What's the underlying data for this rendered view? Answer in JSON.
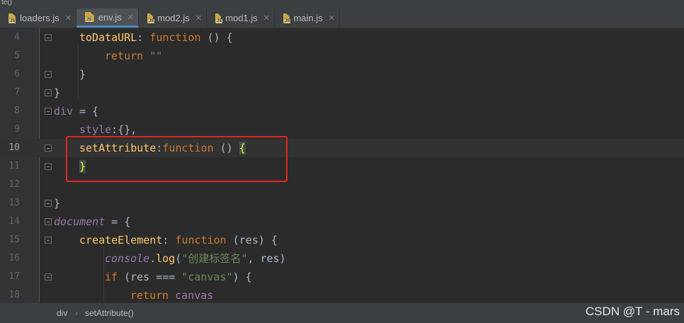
{
  "window": {
    "title_fragment": "te()"
  },
  "tabs": [
    {
      "label": "loaders.js",
      "active": false
    },
    {
      "label": "env.js",
      "active": true
    },
    {
      "label": "mod2.js",
      "active": false
    },
    {
      "label": "mod1.js",
      "active": false
    },
    {
      "label": "main.js",
      "active": false
    }
  ],
  "editor": {
    "lines": [
      {
        "num": "4",
        "code": [
          [
            "prop",
            "toDataURL"
          ],
          [
            "plain",
            ": "
          ],
          [
            "kw",
            "function"
          ],
          [
            "plain",
            " () {"
          ]
        ]
      },
      {
        "num": "5",
        "code": [
          [
            "kw",
            "return"
          ],
          [
            "plain",
            " "
          ],
          [
            "str",
            "\"\""
          ]
        ]
      },
      {
        "num": "6",
        "code": [
          [
            "plain",
            "}"
          ]
        ]
      },
      {
        "num": "7",
        "code": [
          [
            "plain",
            "}"
          ]
        ]
      },
      {
        "num": "8",
        "code": [
          [
            "mem",
            "div"
          ],
          [
            "plain",
            " = {"
          ]
        ]
      },
      {
        "num": "9",
        "code": [
          [
            "mem",
            "style"
          ],
          [
            "plain",
            ":{},"
          ]
        ]
      },
      {
        "num": "10",
        "code": [
          [
            "prop",
            "setAttribute"
          ],
          [
            "plain",
            ":"
          ],
          [
            "kw",
            "function"
          ],
          [
            "plain",
            " () "
          ],
          [
            "hl",
            "{"
          ]
        ]
      },
      {
        "num": "11",
        "code": [
          [
            "hl",
            "}"
          ]
        ]
      },
      {
        "num": "12",
        "code": []
      },
      {
        "num": "13",
        "code": [
          [
            "plain",
            "}"
          ]
        ]
      },
      {
        "num": "14",
        "code": [
          [
            "glob",
            "document"
          ],
          [
            "plain",
            " = {"
          ]
        ]
      },
      {
        "num": "15",
        "code": [
          [
            "prop",
            "createElement"
          ],
          [
            "plain",
            ": "
          ],
          [
            "kw",
            "function"
          ],
          [
            "plain",
            " (res) {"
          ]
        ]
      },
      {
        "num": "16",
        "code": [
          [
            "glob",
            "console"
          ],
          [
            "plain",
            "."
          ],
          [
            "prop2",
            "log"
          ],
          [
            "plain",
            "("
          ],
          [
            "str",
            "\"创建标签名\""
          ],
          [
            "plain",
            ", res)"
          ]
        ]
      },
      {
        "num": "17",
        "code": [
          [
            "kw",
            "if"
          ],
          [
            "plain",
            " (res === "
          ],
          [
            "str",
            "\"canvas\""
          ],
          [
            "plain",
            ") {"
          ]
        ]
      },
      {
        "num": "18",
        "code": [
          [
            "kw",
            "return"
          ],
          [
            "plain",
            " "
          ],
          [
            "mem",
            "canvas"
          ]
        ]
      }
    ]
  },
  "breadcrumb": {
    "items": [
      "div",
      "setAttribute()"
    ],
    "separator": "›"
  },
  "watermark": "CSDN @T - mars",
  "colors": {
    "background": "#2b2b2b",
    "keyword": "#cc7832",
    "string": "#6a8759",
    "function_name": "#ffc66d",
    "member": "#9876aa",
    "annotation_box": "#e0281e"
  }
}
